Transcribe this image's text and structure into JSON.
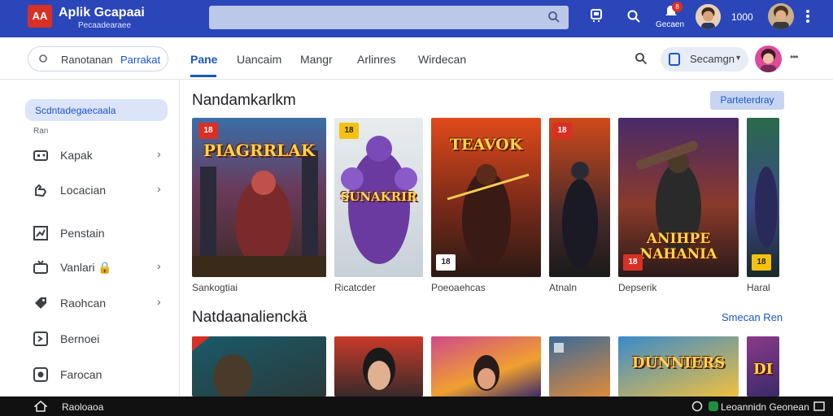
{
  "header": {
    "logo_text": "AA",
    "brand": "Aplik Gcapaai",
    "brand_sub": "Pecaadearaee",
    "search_placeholder": "",
    "label_bell": "Gecaen",
    "badge_count": "8",
    "label_count": "1000"
  },
  "nav": {
    "search_text": "Ranotanan",
    "search_link": "Parrakat",
    "tabs": [
      {
        "label": "Pane"
      },
      {
        "label": "Uancaim"
      },
      {
        "label": "Mangr"
      },
      {
        "label": "Arlinres"
      },
      {
        "label": "Wirdecan"
      }
    ],
    "dropdown_label": "Secamgn",
    "more": "•••"
  },
  "sidebar": {
    "search_label": "Scdntadegaecaala",
    "caption": "Ran",
    "items": [
      {
        "label": "Kapak"
      },
      {
        "label": "Locacian"
      },
      {
        "label": "Penstain"
      },
      {
        "label": "Vanlari 🔒"
      },
      {
        "label": "Raohcan"
      },
      {
        "label": "Bernoei"
      },
      {
        "label": "Farocan"
      }
    ],
    "bottom_label": "Raoloaoa"
  },
  "section1": {
    "title": "Nandamkarlkm",
    "chip": "Parteterdray",
    "cards": [
      {
        "title": "PIAGRRLAK",
        "caption": "Sankogtiai",
        "tag": "18"
      },
      {
        "title": "SUNAKRIR",
        "caption": "Ricatcder",
        "tag": "18"
      },
      {
        "title": "TEAVOK",
        "caption": "Poeoaehcas",
        "tag": "18"
      },
      {
        "title": "",
        "caption": "Atnaln",
        "tag": "18"
      },
      {
        "title": "ANIHPE NAHANIA",
        "caption": "Depserik",
        "tag": "18"
      },
      {
        "title": "",
        "caption": "Haral",
        "tag": "18"
      }
    ]
  },
  "section2": {
    "title": "Natdaanalienckä",
    "see_more": "Smecan Ren",
    "cards": [
      {
        "title": ""
      },
      {
        "title": ""
      },
      {
        "title": ""
      },
      {
        "title": ""
      },
      {
        "title": "DUNNIERS"
      },
      {
        "title": "DI"
      }
    ]
  },
  "footer": {
    "right_text": "Leoannidn Geonean"
  },
  "colors": {
    "header_bg": "#2b46b8",
    "accent": "#1a56c8",
    "chip_bg": "#c7d5f3"
  }
}
